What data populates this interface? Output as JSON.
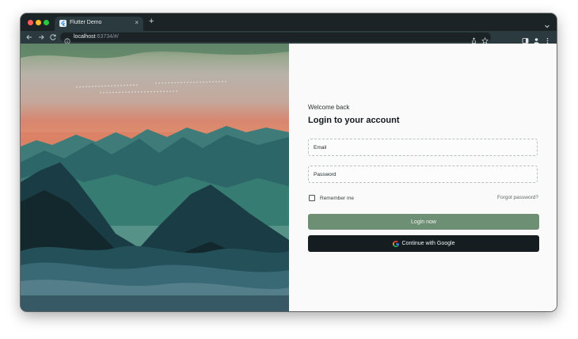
{
  "browser": {
    "tab_title": "Flutter Demo",
    "tab_close": "×",
    "new_tab": "+",
    "url_host": "localhost",
    "url_rest": ":63734/#/"
  },
  "login": {
    "welcome": "Welcome back",
    "heading": "Login to your account",
    "email_label": "Email",
    "password_label": "Password",
    "remember_label": "Remember me",
    "forgot_link": "Forgot password?",
    "login_button": "Login now",
    "google_button": "Continue with Google"
  },
  "colors": {
    "accent": "#6d8f74",
    "dark_button": "#151d20",
    "panel_bg": "#f9faf9"
  },
  "icons": {
    "back": "arrow-left-icon",
    "forward": "arrow-right-icon",
    "reload": "reload-icon",
    "site_info": "info-icon",
    "share": "share-icon",
    "bookmark": "star-icon",
    "side_panel": "side-panel-icon",
    "profile": "profile-icon",
    "menu": "kebab-menu-icon",
    "google": "google-g-icon"
  }
}
